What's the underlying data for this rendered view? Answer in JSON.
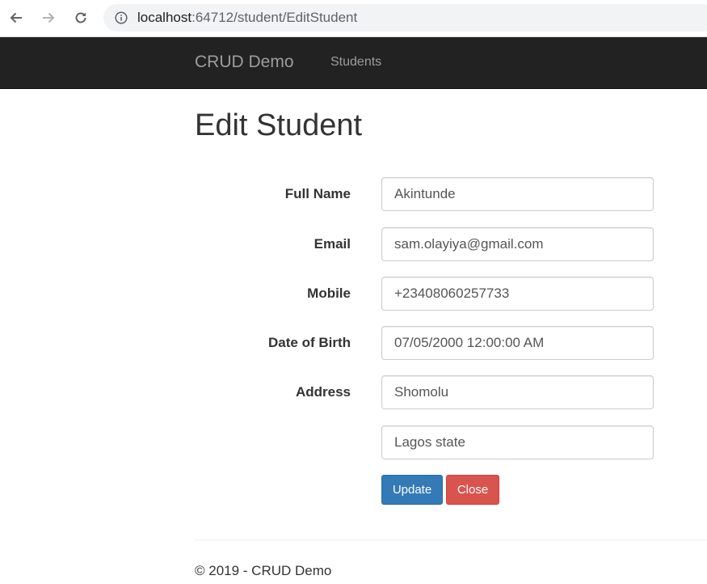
{
  "browser": {
    "url_host": "localhost",
    "url_path": ":64712/student/EditStudent"
  },
  "navbar": {
    "brand": "CRUD Demo",
    "links": [
      "Students"
    ]
  },
  "page": {
    "title": "Edit Student"
  },
  "form": {
    "fields": [
      {
        "label": "Full Name",
        "value": "Akintunde"
      },
      {
        "label": "Email",
        "value": "sam.olayiya@gmail.com"
      },
      {
        "label": "Mobile",
        "value": "+23408060257733"
      },
      {
        "label": "Date of Birth",
        "value": "07/05/2000 12:00:00 AM"
      },
      {
        "label": "Address",
        "value": "Shomolu"
      },
      {
        "label": "",
        "value": "Lagos state"
      }
    ],
    "update_label": "Update",
    "close_label": "Close"
  },
  "footer": {
    "text": "© 2019 - CRUD Demo"
  },
  "colors": {
    "navbar_bg": "#222222",
    "primary": "#337ab7",
    "danger": "#d9534f"
  }
}
